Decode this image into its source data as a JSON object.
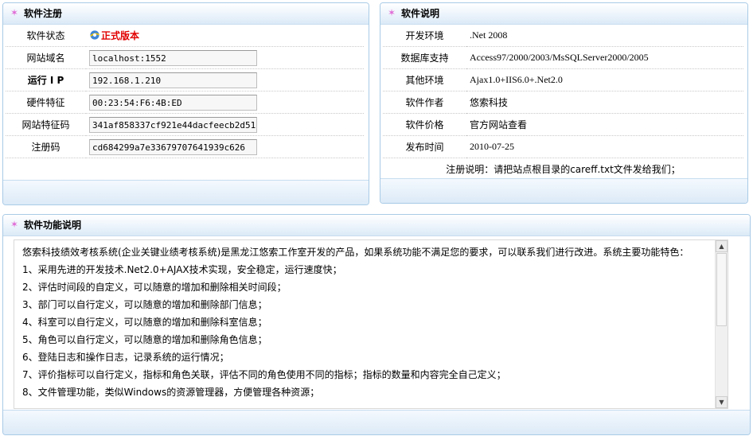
{
  "registration": {
    "title": "软件注册",
    "rows": [
      {
        "label": "软件状态",
        "status": "正式版本"
      },
      {
        "label": "网站域名",
        "value": "localhost:1552"
      },
      {
        "label": "运行 I P",
        "value": "192.168.1.210"
      },
      {
        "label": "硬件特征",
        "value": "00:23:54:F6:4B:ED"
      },
      {
        "label": "网站特征码",
        "value": "341af858337cf921e44dacfeecb2d51"
      },
      {
        "label": "注册码",
        "value": "cd684299a7e33679707641939c626"
      }
    ]
  },
  "info": {
    "title": "软件说明",
    "rows": [
      {
        "label": "开发环境",
        "value": ".Net 2008"
      },
      {
        "label": "数据库支持",
        "value": "Access97/2000/2003/MsSQLServer2000/2005"
      },
      {
        "label": "其他环境",
        "value": "Ajax1.0+IIS6.0+.Net2.0"
      },
      {
        "label": "软件作者",
        "value": "悠索科技"
      },
      {
        "label": "软件价格",
        "value": "官方网站查看"
      },
      {
        "label": "发布时间",
        "value": "2010-07-25"
      }
    ],
    "note": "注册说明：请把站点根目录的careff.txt文件发给我们；"
  },
  "features": {
    "title": "软件功能说明",
    "lines": [
      "悠索科技绩效考核系统(企业关键业绩考核系统)是黑龙江悠索工作室开发的产品，如果系统功能不满足您的要求，可以联系我们进行改进。系统主要功能特色：",
      "1、采用先进的开发技术.Net2.0+AJAX技术实现，安全稳定，运行速度快；",
      "2、评估时间段的自定义，可以随意的增加和删除相关时间段；",
      "3、部门可以自行定义，可以随意的增加和删除部门信息；",
      "4、科室可以自行定义，可以随意的增加和删除科室信息；",
      "5、角色可以自行定义，可以随意的增加和删除角色信息；",
      "6、登陆日志和操作日志，记录系统的运行情况；",
      "7、评价指标可以自行定义，指标和角色关联，评估不同的角色使用不同的指标；指标的数量和内容完全自己定义；",
      "8、文件管理功能，类似Windows的资源管理器，方便管理各种资源；"
    ]
  },
  "icons": {
    "panel": "star-icon",
    "status": "ie-icon",
    "scroll_up": "arrow-up-icon",
    "scroll_down": "arrow-down-icon"
  },
  "colors": {
    "border": "#a9cbe6",
    "status": "#e10000",
    "star": "#e06ad6"
  }
}
